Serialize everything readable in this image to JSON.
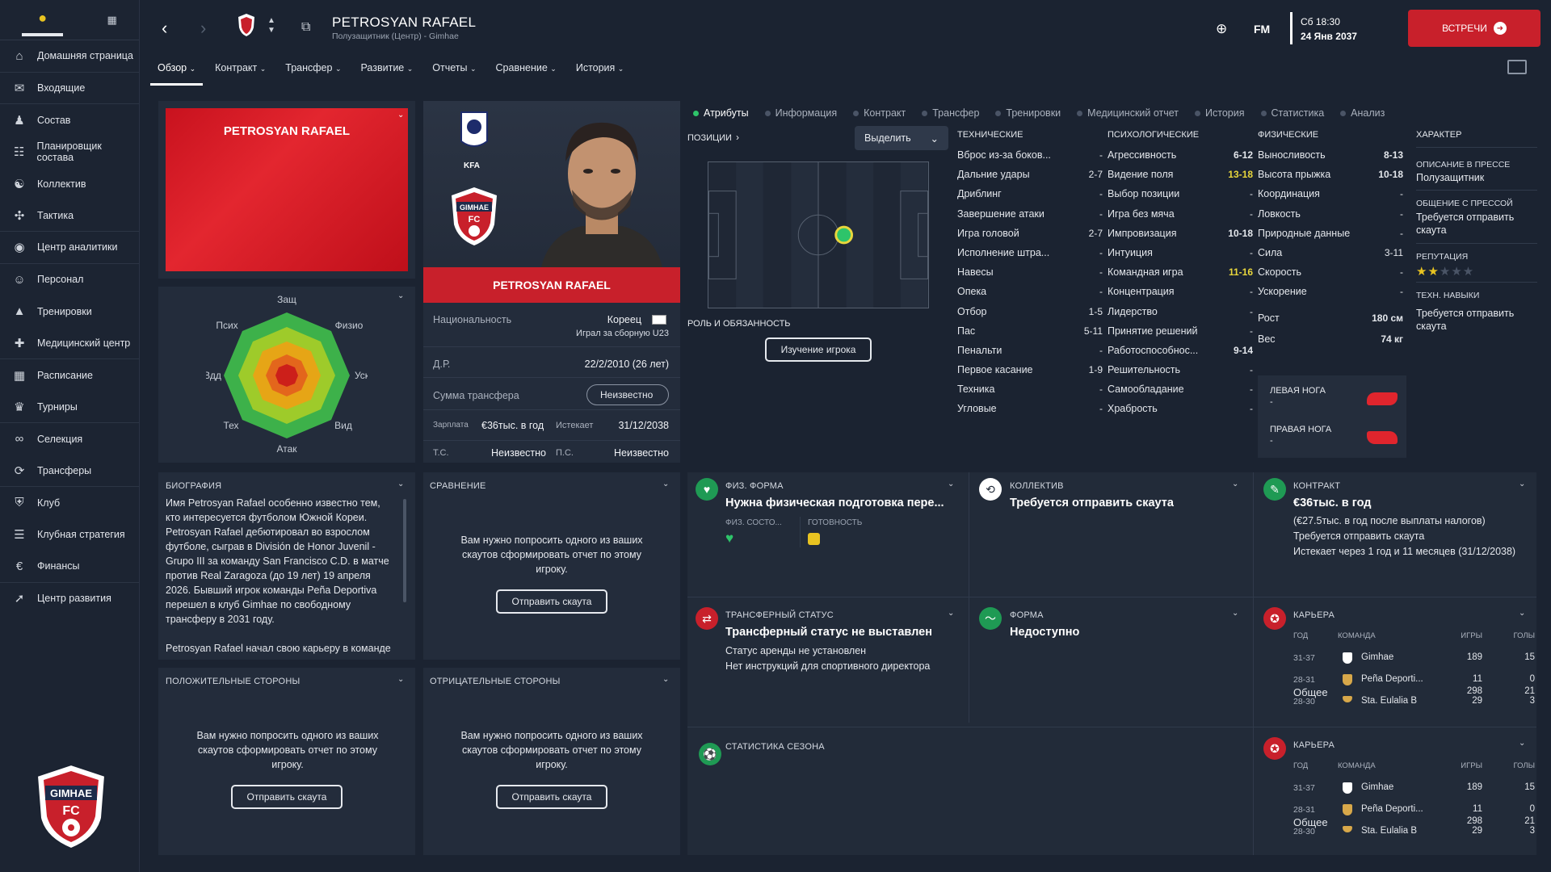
{
  "sidebar": {
    "items": [
      {
        "label": "Домашняя страница",
        "icon": "home-icon"
      },
      {
        "label": "Входящие",
        "icon": "mail-icon"
      },
      {
        "label": "Состав",
        "icon": "squad-icon"
      },
      {
        "label": "Планировщик состава",
        "icon": "planner-icon"
      },
      {
        "label": "Коллектив",
        "icon": "dynamics-icon"
      },
      {
        "label": "Тактика",
        "icon": "tactics-icon"
      },
      {
        "label": "Центр аналитики",
        "icon": "analytics-icon"
      },
      {
        "label": "Персонал",
        "icon": "staff-icon"
      },
      {
        "label": "Тренировки",
        "icon": "training-icon"
      },
      {
        "label": "Медицинский центр",
        "icon": "medical-icon"
      },
      {
        "label": "Расписание",
        "icon": "calendar-icon"
      },
      {
        "label": "Турниры",
        "icon": "trophy-icon"
      },
      {
        "label": "Селекция",
        "icon": "binoculars-icon"
      },
      {
        "label": "Трансферы",
        "icon": "transfer-icon"
      },
      {
        "label": "Клуб",
        "icon": "club-icon"
      },
      {
        "label": "Клубная стратегия",
        "icon": "strategy-icon"
      },
      {
        "label": "Финансы",
        "icon": "finance-icon"
      },
      {
        "label": "Центр развития",
        "icon": "development-icon"
      }
    ]
  },
  "header": {
    "name": "PETROSYAN RAFAEL",
    "subtitle": "Полузащитник (Центр) - Gimhae",
    "fm": "FM",
    "day": "Сб 18:30",
    "date": "24 Янв 2037",
    "meet_btn": "ВСТРЕЧИ"
  },
  "menu": [
    "Обзор",
    "Контракт",
    "Трансфер",
    "Развитие",
    "Отчеты",
    "Сравнение",
    "История"
  ],
  "profile": {
    "banner_name": "PETROSYAN RAFAEL",
    "card_name": "PETROSYAN RAFAEL",
    "kfa": "KFA",
    "nationality_label": "Национальность",
    "nationality": "Кореец",
    "nationality_note": "Играл за сборную U23",
    "dob_label": "Д.Р.",
    "dob": "22/2/2010 (26 лет)",
    "transfer_label": "Сумма трансфера",
    "transfer_value": "Неизвестно",
    "salary_label": "Зарплата",
    "salary": "€36тыс. в год",
    "expires_label": "Истекает",
    "expires": "31/12/2038",
    "ts_label": "Т.С.",
    "ts": "Неизвестно",
    "ps_label": "П.С.",
    "ps": "Неизвестно"
  },
  "radar": {
    "labels": [
      "Защ",
      "Физио",
      "Уск",
      "Вид",
      "Атак",
      "Тех",
      "Вдд",
      "Псих"
    ]
  },
  "tabs": [
    {
      "label": "Атрибуты",
      "active": true
    },
    {
      "label": "Информация"
    },
    {
      "label": "Контракт"
    },
    {
      "label": "Трансфер"
    },
    {
      "label": "Тренировки"
    },
    {
      "label": "Медицинский отчет"
    },
    {
      "label": "История"
    },
    {
      "label": "Статистика"
    },
    {
      "label": "Анализ"
    }
  ],
  "positions": {
    "label": "ПОЗИЦИИ",
    "select": "Выделить",
    "roles_label": "РОЛЬ И ОБЯЗАННОСТЬ",
    "study_btn": "Изучение игрока"
  },
  "technical": {
    "title": "ТЕХНИЧЕСКИЕ",
    "rows": [
      [
        "Вброс из-за боков...",
        "-"
      ],
      [
        "Дальние удары",
        "2-7"
      ],
      [
        "Дриблинг",
        "-"
      ],
      [
        "Завершение атаки",
        "-"
      ],
      [
        "Игра головой",
        "2-7"
      ],
      [
        "Исполнение штра...",
        "-"
      ],
      [
        "Навесы",
        "-"
      ],
      [
        "Опека",
        "-"
      ],
      [
        "Отбор",
        "1-5"
      ],
      [
        "Пас",
        "5-11"
      ],
      [
        "Пенальти",
        "-"
      ],
      [
        "Первое касание",
        "1-9"
      ],
      [
        "Техника",
        "-"
      ],
      [
        "Угловые",
        "-"
      ]
    ]
  },
  "mental": {
    "title": "ПСИХОЛОГИЧЕСКИЕ",
    "rows": [
      [
        "Агрессивность",
        "6-12"
      ],
      [
        "Видение поля",
        "13-18"
      ],
      [
        "Выбор позиции",
        "-"
      ],
      [
        "Игра без мяча",
        "-"
      ],
      [
        "Импровизация",
        "10-18"
      ],
      [
        "Интуиция",
        "-"
      ],
      [
        "Командная игра",
        "11-16"
      ],
      [
        "Концентрация",
        "-"
      ],
      [
        "Лидерство",
        "-"
      ],
      [
        "Принятие решений",
        "-"
      ],
      [
        "Работоспособнос...",
        "9-14"
      ],
      [
        "Решительность",
        "-"
      ],
      [
        "Самообладание",
        "-"
      ],
      [
        "Храбрость",
        "-"
      ]
    ]
  },
  "physical": {
    "title": "ФИЗИЧЕСКИЕ",
    "rows": [
      [
        "Выносливость",
        "8-13"
      ],
      [
        "Высота прыжка",
        "10-18"
      ],
      [
        "Координация",
        "-"
      ],
      [
        "Ловкость",
        "-"
      ],
      [
        "Природные данные",
        "-"
      ],
      [
        "Сила",
        "3-11"
      ],
      [
        "Скорость",
        "-"
      ],
      [
        "Ускорение",
        "-"
      ]
    ],
    "height_label": "Рост",
    "height": "180 см",
    "weight_label": "Вес",
    "weight": "74 кг",
    "left_foot": "ЛЕВАЯ НОГА",
    "left_val": "-",
    "right_foot": "ПРАВАЯ НОГА",
    "right_val": "-"
  },
  "character": {
    "title": "ХАРАКТЕР",
    "press_desc_label": "ОПИСАНИЕ В ПРЕССЕ",
    "press_desc": "Полузащитник",
    "press_talk_label": "ОБЩЕНИЕ С ПРЕССОЙ",
    "press_talk": "Требуется отправить скаута",
    "rep_label": "РЕПУТАЦИЯ",
    "rep_stars": 2,
    "tech_label": "ТЕХН. НАВЫКИ",
    "tech": "Требуется отправить скаута"
  },
  "bio": {
    "title": "БИОГРАФИЯ",
    "text": "Имя Petrosyan Rafael особенно известно тем, кто интересуется футболом Южной Кореи. Petrosyan Rafael дебютировал во взрослом футболе, сыграв в División de Honor Juvenil - Grupo III за команду San Francisco C.D. в матче против Real Zaragoza (до 19 лет) 19 апреля 2026. Бывший игрок команды Peña Deportiva перешел в клуб Gimhae по свободному трансферу в 2031 году.",
    "text2": "Petrosyan Rafael начал свою карьеру в команде"
  },
  "compare": {
    "title": "СРАВНЕНИЕ",
    "msg": "Вам нужно попросить одного из ваших скаутов сформировать отчет по этому игроку.",
    "btn": "Отправить скаута"
  },
  "pos_sides": {
    "title": "ПОЛОЖИТЕЛЬНЫЕ СТОРОНЫ",
    "msg": "Вам нужно попросить одного из ваших скаутов сформировать отчет по этому игроку.",
    "btn": "Отправить скаута"
  },
  "neg_sides": {
    "title": "ОТРИЦАТЕЛЬНЫЕ СТОРОНЫ",
    "msg": "Вам нужно попросить одного из ваших скаутов сформировать отчет по этому игроку.",
    "btn": "Отправить скаута"
  },
  "fitness": {
    "title": "ФИЗ. ФОРМА",
    "headline": "Нужна физическая подготовка пере...",
    "cond_label": "ФИЗ. СОСТО...",
    "ready_label": "ГОТОВНОСТЬ"
  },
  "team": {
    "title": "КОЛЛЕКТИВ",
    "headline": "Требуется отправить скаута"
  },
  "contract": {
    "title": "КОНТРАКТ",
    "headline": "€36тыс. в год",
    "l1": "(€27.5тыс. в год после выплаты налогов)",
    "l2": "Требуется отправить скаута",
    "l3": "Истекает через 1 год и 11 месяцев (31/12/2038)"
  },
  "transfer_status": {
    "title": "ТРАНСФЕРНЫЙ СТАТУС",
    "headline": "Трансферный статус не выставлен",
    "l1": "Статус аренды не установлен",
    "l2": "Нет инструкций для спортивного директора"
  },
  "form": {
    "title": "ФОРМА",
    "headline": "Недоступно"
  },
  "season_stats": {
    "title": "СТАТИСТИКА СЕЗОНА"
  },
  "career": {
    "title": "КАРЬЕРА",
    "cols": [
      "ГОД",
      "КОМАНДА",
      "ИГРЫ",
      "ГОЛЫ"
    ],
    "rows": [
      [
        "31-37",
        "Gimhae",
        "189",
        "15"
      ],
      [
        "28-31",
        "Peña Deporti...",
        "11",
        "0"
      ],
      [
        "28-30",
        "Sta. Eulalia B",
        "29",
        "3"
      ]
    ],
    "total_label": "Общее",
    "total_games": "298",
    "total_goals": "21"
  },
  "colors": {
    "accent_red": "#c8202b",
    "panel": "#232c3b",
    "bg": "#1b2331",
    "green": "#2ec46a",
    "yellow": "#e8d63c"
  }
}
